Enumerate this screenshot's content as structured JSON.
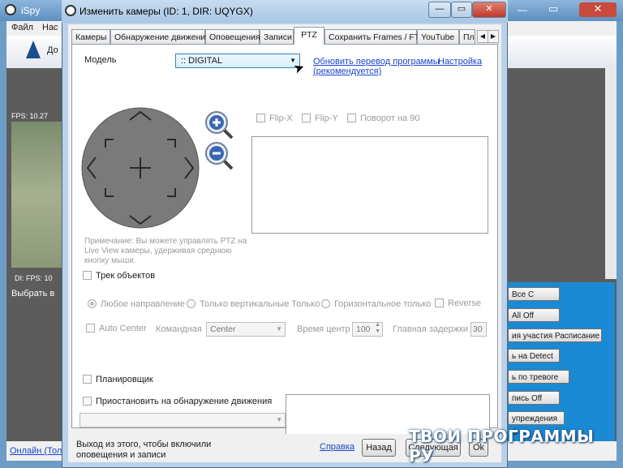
{
  "app": {
    "title": "iSpy",
    "menu": [
      "Файл",
      "Нас"
    ],
    "toolbar_text": "До",
    "cam_overlay_top": "FPS: 10.27",
    "cam_overlay_bottom": "DI: FPS: 10",
    "cam_select_text": "Выбрать в",
    "status_text": "Онлайн (Тол",
    "right_buttons": [
      "Все С",
      "All Off",
      "ия участия Расписание",
      "ь на Detect",
      "ь по тревоге",
      "пись Off",
      "упреждения С"
    ]
  },
  "dialog": {
    "title": "Изменить камеры (ID: 1, DIR: UQYGX)",
    "tabs": [
      "Камеры",
      "Обнаружение движения",
      "Оповещения",
      "Записи",
      "PTZ",
      "Сохранить Frames / FTP",
      "YouTube",
      "Пл"
    ],
    "active_tab": "PTZ",
    "model_label": "Модель",
    "model_value": ":: DIGITAL",
    "update_link": "Обновить перевод программы",
    "update_link_2": "(рекомендуется)",
    "settings_link": "Настройка",
    "flip_x": "Flip-X",
    "flip_y": "Flip-Y",
    "rotate_90": "Поворот на 90",
    "note": [
      "Примечание: Вы можете управлять PTZ на",
      "Live View камеры, удерживая среднюю",
      "кнопку мыши."
    ],
    "track_objects": "Трек объектов",
    "any_direction": "Любое направление",
    "vertical_only": "Только вертикальные Только",
    "horizontal_only": "Горизонтальное только",
    "reverse": "Reverse",
    "auto_center": "Auto Center",
    "command_label": "Командная",
    "command_value": "Center",
    "center_time_label": "Время центр",
    "center_time_value": "100",
    "main_delay_label": "Главная задержки",
    "main_delay_value": "30",
    "scheduler": "Планировщик",
    "pause_motion": "Приостановить на обнаружение движения",
    "footer_note": [
      "Выход из этого, чтобы включили",
      "оповещения и записи"
    ],
    "help_link": "Справка",
    "back_button": "Назад",
    "next_button": "Следующая",
    "ok_button": "Ok"
  },
  "watermark": "ТВОИ ПРОГРАММЫ РУ",
  "colors": {
    "accent_blue": "#1a8ad4",
    "link": "#1a44cc"
  }
}
